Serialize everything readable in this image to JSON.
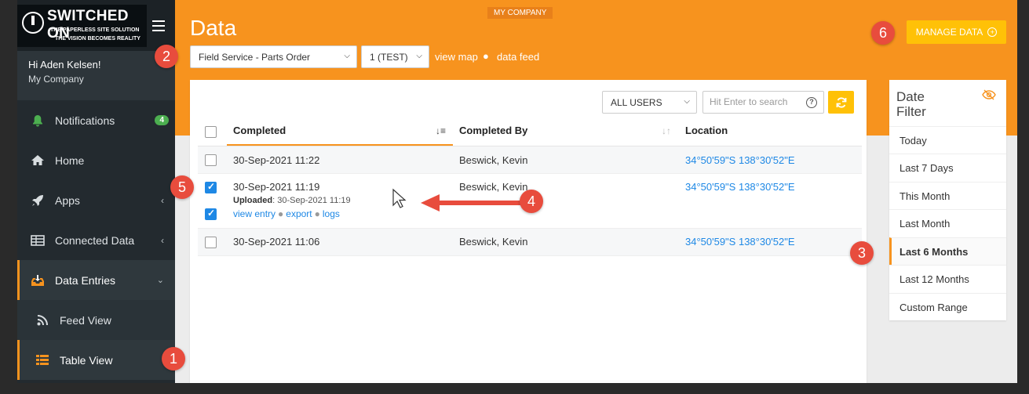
{
  "window": {
    "background": "#2a2a2a"
  },
  "sidebar": {
    "logo": {
      "title": "SWITCHED ON",
      "tagline1": "THE PAPERLESS SITE SOLUTION",
      "tagline2": "THE VISION BECOMES REALITY"
    },
    "user": {
      "greeting": "Hi Aden Kelsen!",
      "company": "My Company"
    },
    "items": [
      {
        "label": "Notifications",
        "icon": "bell-icon",
        "badge": "4"
      },
      {
        "label": "Home",
        "icon": "home-icon"
      },
      {
        "label": "Apps",
        "icon": "rocket-icon"
      },
      {
        "label": "Connected Data",
        "icon": "table-icon"
      },
      {
        "label": "Data Entries",
        "icon": "inbox-download-icon"
      },
      {
        "label": "Feed View",
        "icon": "rss-icon"
      },
      {
        "label": "Table View",
        "icon": "list-icon"
      }
    ],
    "accent": "#f7931e"
  },
  "header": {
    "company_tag": "MY COMPANY",
    "title": "Data",
    "form_select": "Field Service - Parts Order",
    "version_select": "1 (TEST)",
    "link_map": "view map",
    "link_feed": "data feed",
    "manage_button": "MANAGE DATA",
    "orange": "#f7931e"
  },
  "toolbar": {
    "users_select": "ALL USERS",
    "search_placeholder": "Hit Enter to search"
  },
  "table": {
    "columns": [
      "Completed",
      "Completed By",
      "Location"
    ],
    "rows": [
      {
        "completed": "30-Sep-2021 11:22",
        "by": "Beswick, Kevin",
        "location": "34°50'59\"S 138°30'52\"E"
      },
      {
        "completed": "30-Sep-2021 11:19",
        "by": "Beswick, Kevin",
        "location": "34°50'59\"S 138°30'52\"E",
        "uploaded_label": "Uploaded",
        "uploaded_value": ": 30-Sep-2021 11:19",
        "link_view": "view entry",
        "link_export": "export",
        "link_logs": "logs"
      },
      {
        "completed": "30-Sep-2021 11:06",
        "by": "Beswick, Kevin",
        "location": "34°50'59\"S 138°30'52\"E"
      }
    ]
  },
  "date_filter": {
    "title_line1": "Date",
    "title_line2": "Filter",
    "options": [
      "Today",
      "Last 7 Days",
      "This Month",
      "Last Month",
      "Last 6 Months",
      "Last 12 Months",
      "Custom Range"
    ],
    "selected": "Last 6 Months"
  },
  "annotations": [
    "1",
    "2",
    "3",
    "4",
    "5",
    "6"
  ]
}
